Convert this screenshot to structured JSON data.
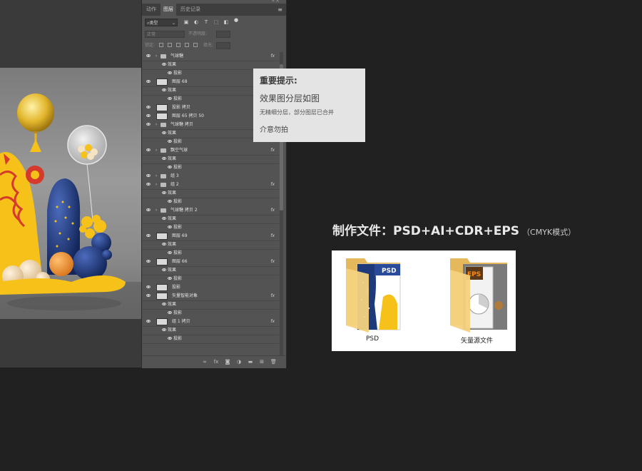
{
  "panel": {
    "tabs": [
      "动作",
      "图层",
      "历史记录"
    ],
    "active_tab": "图层",
    "filter_label": "类型",
    "blend_mode": "正常",
    "opacity_label": "不透明度:",
    "lock_label": "锁定:",
    "fill_label": "填充:"
  },
  "layers": [
    {
      "name": "气球糖",
      "type": "group",
      "fx": "fx"
    },
    {
      "name": "效果",
      "type": "effects"
    },
    {
      "name": "投影",
      "type": "effect"
    },
    {
      "name": "图层 68",
      "type": "layer",
      "fx": "fx"
    },
    {
      "name": "效果",
      "type": "effects"
    },
    {
      "name": "投影",
      "type": "effect"
    },
    {
      "name": "投影 拷贝",
      "type": "layer"
    },
    {
      "name": "图层 65 拷贝 50",
      "type": "layer"
    },
    {
      "name": "气球糖 拷贝",
      "type": "group"
    },
    {
      "name": "效果",
      "type": "effects"
    },
    {
      "name": "投影",
      "type": "effect"
    },
    {
      "name": "飘空气球",
      "type": "group",
      "fx": "fx"
    },
    {
      "name": "效果",
      "type": "effects"
    },
    {
      "name": "投影",
      "type": "effect"
    },
    {
      "name": "组 3",
      "type": "group"
    },
    {
      "name": "组 2",
      "type": "group",
      "fx": "fx"
    },
    {
      "name": "效果",
      "type": "effects"
    },
    {
      "name": "投影",
      "type": "effect"
    },
    {
      "name": "气球糖 拷贝 2",
      "type": "group",
      "fx": "fx"
    },
    {
      "name": "效果",
      "type": "effects"
    },
    {
      "name": "投影",
      "type": "effect"
    },
    {
      "name": "图层 69",
      "type": "layer",
      "fx": "fx"
    },
    {
      "name": "效果",
      "type": "effects"
    },
    {
      "name": "投影",
      "type": "effect"
    },
    {
      "name": "图层 66",
      "type": "layer",
      "fx": "fx"
    },
    {
      "name": "效果",
      "type": "effects"
    },
    {
      "name": "投影",
      "type": "effect"
    },
    {
      "name": "投影",
      "type": "layer"
    },
    {
      "name": "矢量智能对象",
      "type": "layer",
      "fx": "fx"
    },
    {
      "name": "效果",
      "type": "effects"
    },
    {
      "name": "投影",
      "type": "effect"
    },
    {
      "name": "组 1 拷贝",
      "type": "layer",
      "fx": "fx"
    },
    {
      "name": "效果",
      "type": "effects"
    },
    {
      "name": "投影",
      "type": "effect"
    }
  ],
  "tip": {
    "title": "重要提示:",
    "line1": "效果图分层如图",
    "line2": "无精细分层，部分图层已合并",
    "line3": "介意勿拍"
  },
  "heading": {
    "main": "制作文件：PSD+AI+CDR+EPS",
    "sub": "（CMYK模式）"
  },
  "files": [
    {
      "label": "PSD",
      "icon": "psd-folder-icon"
    },
    {
      "label": "矢量源文件",
      "icon": "eps-folder-icon"
    }
  ],
  "colors": {
    "yellow": "#f6c21a",
    "navy": "#1f3a7a",
    "red": "#d63a2a",
    "orange": "#f0902a",
    "folder": "#f4d27e"
  }
}
